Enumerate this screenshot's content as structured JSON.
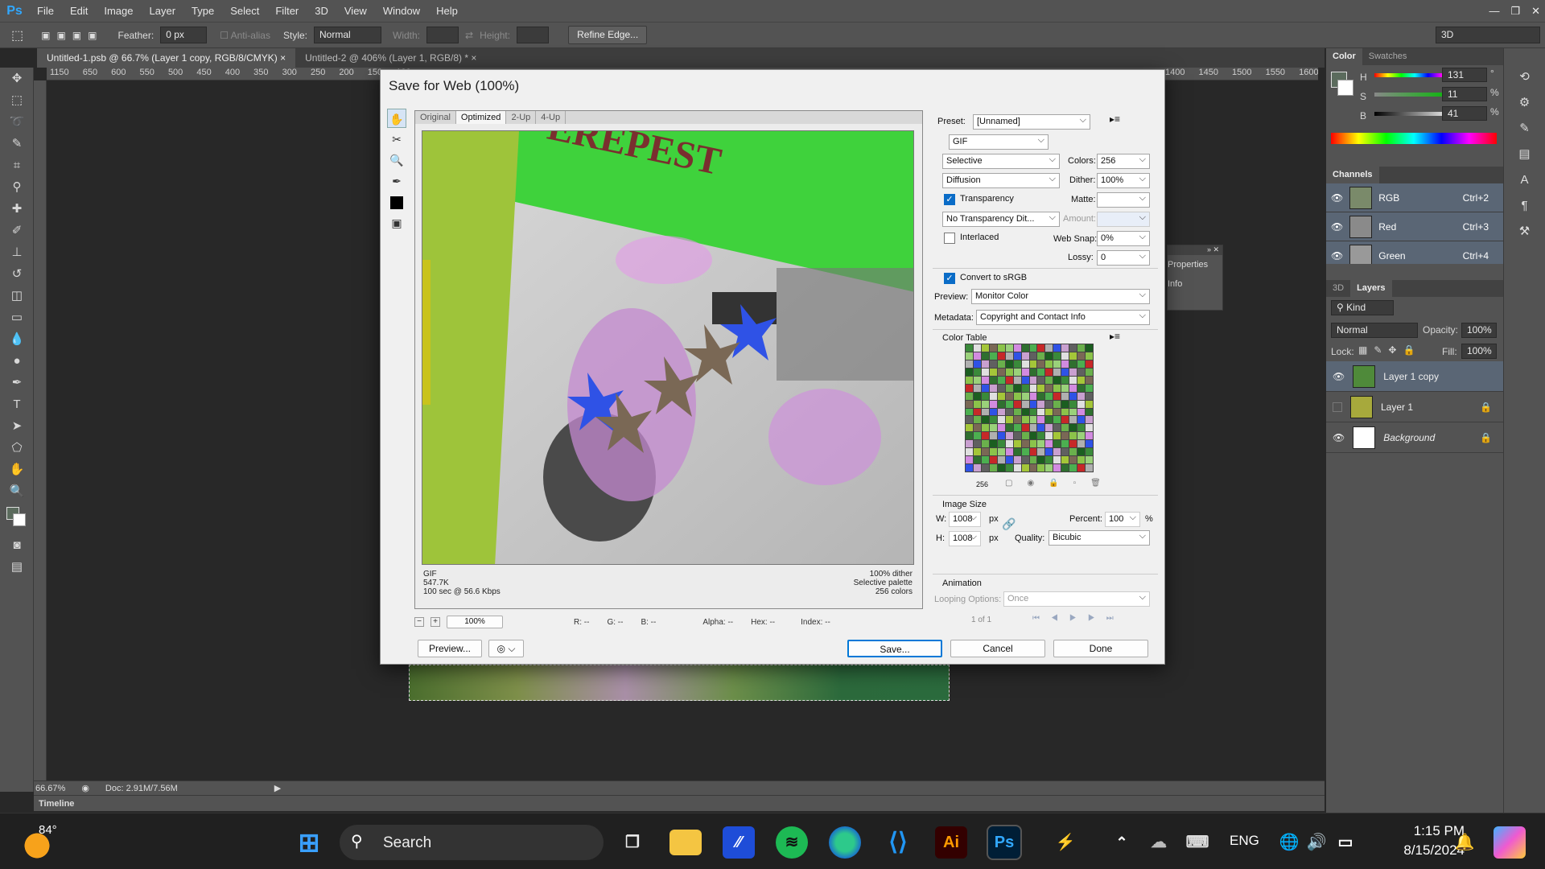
{
  "app": {
    "logo": "Ps",
    "menu": [
      "File",
      "Edit",
      "Image",
      "Layer",
      "Type",
      "Select",
      "Filter",
      "3D",
      "View",
      "Window",
      "Help"
    ],
    "window_controls": [
      "—",
      "❐",
      "✕"
    ]
  },
  "options": {
    "feather_label": "Feather:",
    "feather_value": "0 px",
    "antialias_label": "Anti-alias",
    "style_label": "Style:",
    "style_value": "Normal",
    "width_label": "Width:",
    "height_label": "Height:",
    "refine_edge": "Refine Edge...",
    "workspace": "3D"
  },
  "doc_tabs": [
    {
      "label": "Untitled-1.psb @ 66.7% (Layer 1 copy, RGB/8/CMYK)",
      "close": "×"
    },
    {
      "label": "Untitled-2 @ 406% (Layer 1, RGB/8) *",
      "close": "×"
    }
  ],
  "ruler_h": "1150 650 600 550 500 450 400 350 300 250 200 150 100",
  "ruler_h_right": "1400 1450 1500 1550 1600 165",
  "status": {
    "zoom": "66.67%",
    "doc": "Doc: 2.91M/7.56M",
    "timeline": "Timeline"
  },
  "color_panel": {
    "tabs": [
      "Color",
      "Swatches"
    ],
    "h_label": "H",
    "h_value": "131",
    "h_unit": "°",
    "s_label": "S",
    "s_value": "11",
    "s_unit": "%",
    "b_label": "B",
    "b_value": "41",
    "b_unit": "%"
  },
  "channels": {
    "title": "Channels",
    "rows": [
      {
        "name": "RGB",
        "shortcut": "Ctrl+2"
      },
      {
        "name": "Red",
        "shortcut": "Ctrl+3"
      },
      {
        "name": "Green",
        "shortcut": "Ctrl+4"
      }
    ]
  },
  "layers": {
    "tabs": [
      "3D",
      "Layers"
    ],
    "kind": "Kind",
    "blend": "Normal",
    "opacity_label": "Opacity:",
    "opacity": "100%",
    "lock_label": "Lock:",
    "fill_label": "Fill:",
    "fill": "100%",
    "rows": [
      {
        "name": "Layer 1 copy"
      },
      {
        "name": "Layer 1"
      },
      {
        "name": "Background"
      }
    ]
  },
  "float_panel": {
    "items": [
      "Properties",
      "Info"
    ]
  },
  "dialog": {
    "title": "Save for Web (100%)",
    "view_tabs": [
      "Original",
      "Optimized",
      "2-Up",
      "4-Up"
    ],
    "preview_text": "EREPEST",
    "info_left": [
      "GIF",
      "547.7K",
      "100 sec @ 56.6 Kbps"
    ],
    "info_right": [
      "100% dither",
      "Selective palette",
      "256 colors"
    ],
    "zoom": "100%",
    "readouts": {
      "r": "R: --",
      "g": "G: --",
      "b": "B: --",
      "alpha": "Alpha: --",
      "hex": "Hex: --",
      "index": "Index: --"
    },
    "buttons": {
      "preview": "Preview...",
      "save": "Save...",
      "cancel": "Cancel",
      "done": "Done"
    },
    "settings": {
      "preset_label": "Preset:",
      "preset": "[Unnamed]",
      "format": "GIF",
      "reduction": "Selective",
      "colors_label": "Colors:",
      "colors": "256",
      "dither_algo": "Diffusion",
      "dither_label": "Dither:",
      "dither": "100%",
      "transparency": "Transparency",
      "matte_label": "Matte:",
      "trans_dither": "No Transparency Dit...",
      "amount_label": "Amount:",
      "interlaced": "Interlaced",
      "websnap_label": "Web Snap:",
      "websnap": "0%",
      "lossy_label": "Lossy:",
      "lossy": "0",
      "srgb": "Convert to sRGB",
      "preview_label": "Preview:",
      "preview_value": "Monitor Color",
      "metadata_label": "Metadata:",
      "metadata_value": "Copyright and Contact Info",
      "color_table_label": "Color Table",
      "color_count": "256",
      "image_size_label": "Image Size",
      "w_label": "W:",
      "w": "1008",
      "h_label": "H:",
      "h": "1008",
      "px": "px",
      "percent_label": "Percent:",
      "percent": "100",
      "pct": "%",
      "quality_label": "Quality:",
      "quality": "Bicubic",
      "animation_label": "Animation",
      "looping_label": "Looping Options:",
      "looping": "Once",
      "frame": "1 of 1"
    }
  },
  "taskbar": {
    "weather": "84°",
    "search": "Search",
    "lang": "ENG",
    "time": "1:15 PM",
    "date": "8/15/2024"
  },
  "colors": {
    "accent": "#0078d7",
    "ps_blue": "#31a8ff",
    "panel": "#535353"
  }
}
